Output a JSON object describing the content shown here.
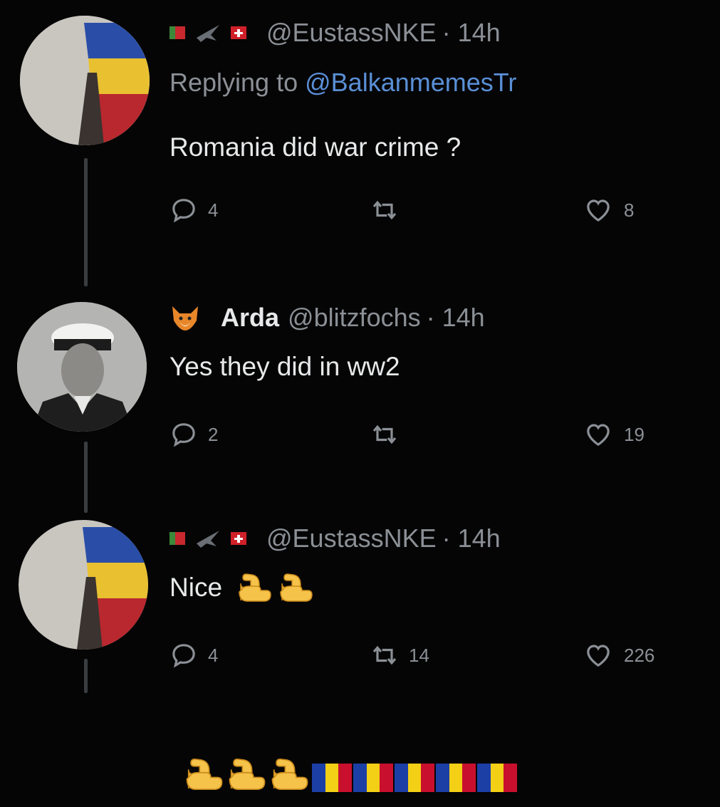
{
  "colors": {
    "background": "#050505",
    "text": "#e7e9ea",
    "muted": "#8b9096",
    "mention": "#5a8fd6",
    "thread_line": "#3a3d40"
  },
  "tweets": [
    {
      "handle": "@EustassNKE",
      "time": "· 14h",
      "replying_prefix": "Replying to",
      "replying_to": "@BalkanmemesTr",
      "text": "Romania did war crime ?",
      "replies": "4",
      "retweets": "",
      "likes": "8",
      "header_icons": [
        "flag-icon",
        "bird-icon",
        "flag-icon"
      ]
    },
    {
      "display_name": "Arda",
      "handle": "@blitzfochs",
      "time": "· 14h",
      "text": "Yes they did in ww2",
      "replies": "2",
      "retweets": "",
      "likes": "19",
      "header_icons": [
        "fox-emoji-icon"
      ]
    },
    {
      "handle": "@EustassNKE",
      "time": "· 14h",
      "text": "Nice",
      "replies": "4",
      "retweets": "14",
      "likes": "226",
      "header_icons": [
        "flag-icon",
        "bird-icon",
        "flag-icon"
      ],
      "emojis": [
        "flexed-biceps-icon",
        "flexed-biceps-icon"
      ]
    }
  ],
  "caption": {
    "emojis": [
      "flexed-biceps-icon",
      "flexed-biceps-icon",
      "flexed-biceps-icon",
      "romania-flag-icon",
      "romania-flag-icon",
      "romania-flag-icon",
      "romania-flag-icon",
      "romania-flag-icon"
    ],
    "flag_colors": [
      "#1c3fa6",
      "#f3cf16",
      "#c8102e"
    ]
  }
}
